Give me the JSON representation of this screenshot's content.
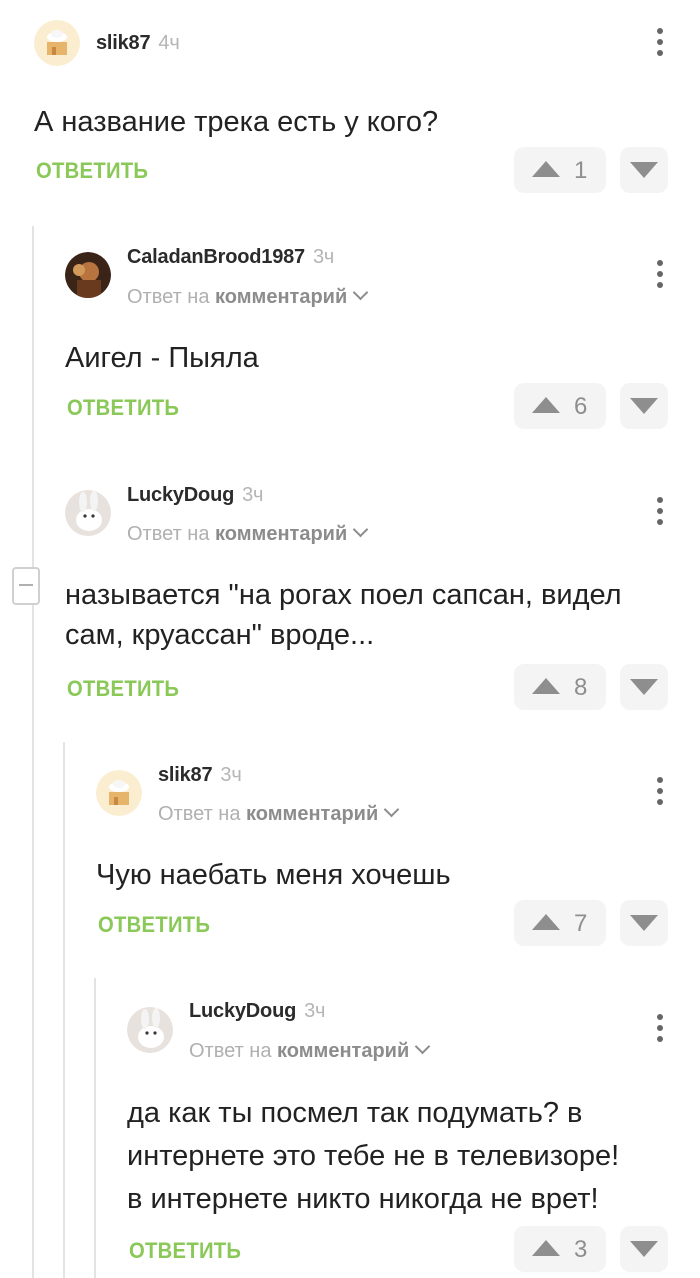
{
  "comments": [
    {
      "author": "slik87",
      "time": "4ч",
      "text": "А название трека есть у кого?",
      "reply_to": null,
      "reply_label": "ОТВЕТИТЬ",
      "rating": "1"
    },
    {
      "author": "CaladanBrood1987",
      "time": "3ч",
      "reply_prefix": "Ответ на",
      "reply_target": "комментарий",
      "text": "Аигел - Пыяла",
      "reply_label": "ОТВЕТИТЬ",
      "rating": "6"
    },
    {
      "author": "LuckyDoug",
      "time": "3ч",
      "reply_prefix": "Ответ на",
      "reply_target": "комментарий",
      "text_line1": "называется \"на рогах поел сапсан, видел",
      "text_line2": "сам, круассан\" вроде...",
      "reply_label": "ОТВЕТИТЬ",
      "rating": "8"
    },
    {
      "author": "slik87",
      "time": "3ч",
      "reply_prefix": "Ответ на",
      "reply_target": "комментарий",
      "text": "Чую наебать меня хочешь",
      "reply_label": "ОТВЕТИТЬ",
      "rating": "7"
    },
    {
      "author": "LuckyDoug",
      "time": "3ч",
      "reply_prefix": "Ответ на",
      "reply_target": "комментарий",
      "text_line1": "да как ты посмел так подумать? в",
      "text_line2": "интернете это тебе не в телевизоре!",
      "text_line3": "в интернете никто никогда не врет!",
      "reply_label": "ОТВЕТИТЬ",
      "rating": "3"
    }
  ],
  "colors": {
    "accent_green": "#8ac858",
    "vote_bg": "#f4f4f4",
    "thread_line": "#e3e3e3"
  },
  "icons": {
    "vote_up": "triangle-up-icon",
    "vote_down": "triangle-down-icon",
    "more": "more-vertical-icon",
    "collapse": "minus-box-icon",
    "chevron": "chevron-down-icon"
  }
}
